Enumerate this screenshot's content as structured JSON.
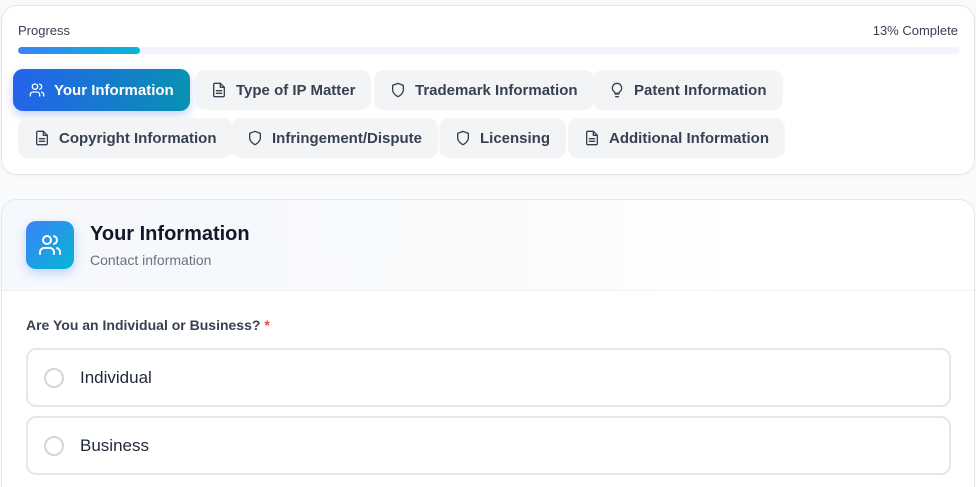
{
  "progress": {
    "label": "Progress",
    "complete_text": "13% Complete",
    "percent": 13,
    "fill_colors": [
      "#3b82f6",
      "#06b6d4"
    ]
  },
  "tabs": [
    {
      "label": "Your Information",
      "icon": "users-icon",
      "active": true
    },
    {
      "label": "Type of IP Matter",
      "icon": "document-icon",
      "active": false
    },
    {
      "label": "Trademark Information",
      "icon": "shield-icon",
      "active": false
    },
    {
      "label": "Patent Information",
      "icon": "lightbulb-icon",
      "active": false
    },
    {
      "label": "Copyright Information",
      "icon": "document-icon",
      "active": false
    },
    {
      "label": "Infringement/Dispute",
      "icon": "shield-icon",
      "active": false
    },
    {
      "label": "Licensing",
      "icon": "shield-icon",
      "active": false
    },
    {
      "label": "Additional Information",
      "icon": "document-icon",
      "active": false
    }
  ],
  "section": {
    "icon": "users-icon",
    "title": "Your Information",
    "subtitle": "Contact information"
  },
  "question": {
    "label": "Are You an Individual or Business?",
    "required_mark": "*",
    "options": [
      {
        "label": "Individual",
        "selected": false
      },
      {
        "label": "Business",
        "selected": false
      }
    ]
  },
  "colors": {
    "accent": "#2563eb",
    "accent_secondary": "#0891b2",
    "required": "#ef4444"
  }
}
